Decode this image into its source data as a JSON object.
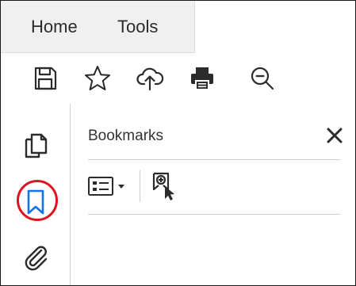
{
  "menubar": {
    "home_label": "Home",
    "tools_label": "Tools"
  },
  "toolbar": {
    "icons": [
      "save-icon",
      "bookmark-star-icon",
      "cloud-upload-icon",
      "print-icon",
      "zoom-out-icon"
    ]
  },
  "nav_rail": {
    "icons": [
      "page-thumbnails-icon",
      "bookmarks-icon",
      "attachments-icon"
    ],
    "active": "bookmarks-icon",
    "highlight_color": "#e0141e"
  },
  "bookmarks_panel": {
    "title": "Bookmarks",
    "close_icon": "close-icon",
    "tools": [
      "options-menu-icon",
      "new-bookmark-icon"
    ]
  },
  "colors": {
    "icon": "#2b2b2b",
    "active": "#1473e6",
    "highlight": "#e0141e",
    "menubar_bg": "#f0f0f0"
  }
}
